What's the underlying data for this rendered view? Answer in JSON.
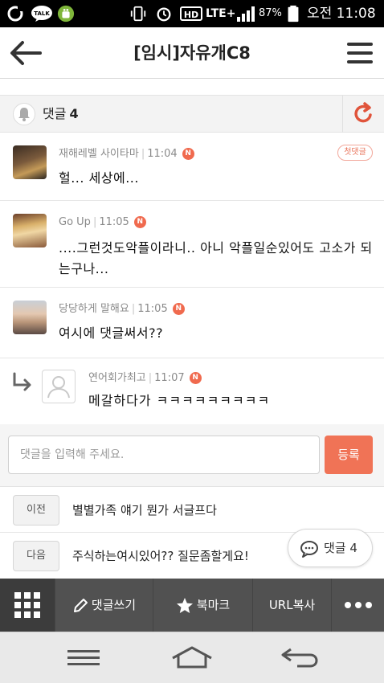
{
  "status_bar": {
    "battery": "87%",
    "network": "LTE+",
    "time": "오전 11:08"
  },
  "header": {
    "title": "[임시]자유개C8"
  },
  "comments_header": {
    "label": "댓글",
    "count": "4"
  },
  "comments": [
    {
      "author": "재해레벨 사이타마",
      "time": "11:04",
      "new_badge": "N",
      "first_badge": "첫댓글",
      "text": "헐... 세상에...",
      "is_reply": false
    },
    {
      "author": "Go Up",
      "time": "11:05",
      "new_badge": "N",
      "text": "....그런것도악플이라니.. 아니 악플일순있어도 고소가 되는구나...",
      "is_reply": false
    },
    {
      "author": "당당하게 말해요",
      "time": "11:05",
      "new_badge": "N",
      "text": "여시에 댓글써서??",
      "is_reply": false
    },
    {
      "author": "연어회가최고",
      "time": "11:07",
      "new_badge": "N",
      "text": "메갈하다가 ㅋㅋㅋㅋㅋㅋㅋㅋㅋ",
      "is_reply": true
    }
  ],
  "comment_input": {
    "placeholder": "댓글을 입력해 주세요.",
    "value": "",
    "submit_label": "등록"
  },
  "navigation": {
    "prev_label": "이전",
    "prev_title": "별별가족 얘기 뭔가 서글프다",
    "next_label": "다음",
    "next_title": "주식하는여시있어?? 질문좀할게요!"
  },
  "floating_comment": {
    "label": "댓글",
    "count": "4"
  },
  "toolbar": {
    "write_comment": "댓글쓰기",
    "bookmark": "북마크",
    "copy_url": "URL복사"
  },
  "colors": {
    "accent": "#f07356",
    "badge": "#f06a4e",
    "toolbar_bg": "#515151",
    "toolbar_grid_bg": "#3c3c3c"
  },
  "icons": {
    "status_left": [
      "o-app-icon",
      "talk-icon",
      "android-icon"
    ],
    "status_right": [
      "vibrate-icon",
      "alarm-icon",
      "hd-icon",
      "signal-icon",
      "battery-icon"
    ],
    "header": [
      "back-arrow-icon",
      "hamburger-menu-icon"
    ],
    "toolbar": [
      "grid-icon",
      "pencil-icon",
      "star-icon",
      "more-icon"
    ],
    "system_nav": [
      "system-menu-icon",
      "system-home-icon",
      "system-back-icon"
    ]
  }
}
